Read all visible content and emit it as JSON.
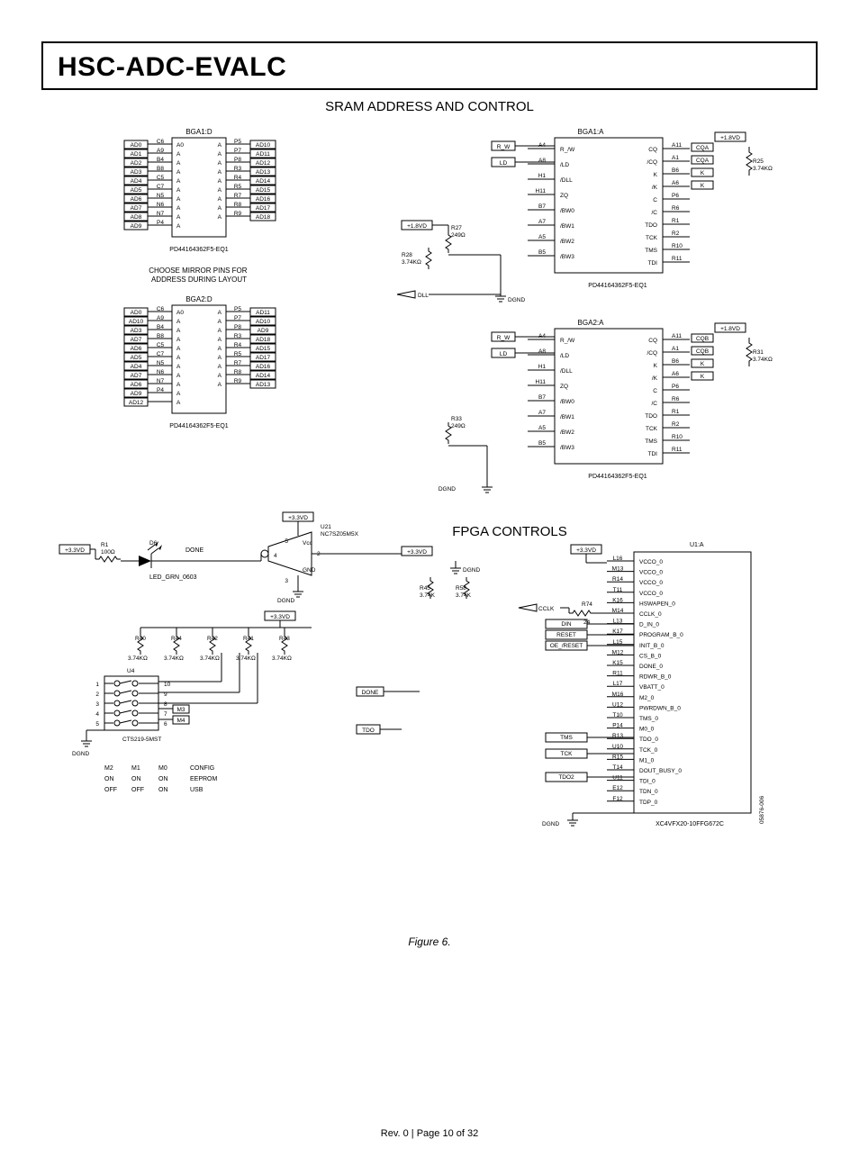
{
  "header": {
    "title": "HSC-ADC-EVALC"
  },
  "section1": {
    "title": "SRAM ADDRESS AND CONTROL"
  },
  "section2": {
    "title": "FPGA CONTROLS"
  },
  "figure_caption": "Figure 6.",
  "footer": "Rev. 0 | Page 10 of 32",
  "side_marker": "05876-006",
  "bga1d": {
    "name": "BGA1:D",
    "part": "PD44164362F5-EQ1",
    "left": [
      "AD0",
      "AD1",
      "AD2",
      "AD3",
      "AD4",
      "AD5",
      "AD6",
      "AD7",
      "AD8",
      "AD9"
    ],
    "left_pins": [
      "C6",
      "A9",
      "B4",
      "B8",
      "C5",
      "C7",
      "N5",
      "N6",
      "N7",
      "P4"
    ],
    "left_sig": [
      "A0",
      "A",
      "A",
      "A",
      "A",
      "A",
      "A",
      "A",
      "A",
      "A"
    ],
    "right_sig": [
      "A",
      "A",
      "A",
      "A",
      "A",
      "A",
      "A",
      "A",
      "A"
    ],
    "right_pins": [
      "P5",
      "P7",
      "P8",
      "R3",
      "R4",
      "R5",
      "R7",
      "R8",
      "R9"
    ],
    "right": [
      "AD10",
      "AD11",
      "AD12",
      "AD13",
      "AD14",
      "AD15",
      "AD16",
      "AD17",
      "AD18"
    ]
  },
  "note1": "CHOOSE MIRROR PINS FOR\nADDRESS DURING LAYOUT",
  "bga2d": {
    "name": "BGA2:D",
    "part": "PD44164362F5-EQ1",
    "left": [
      "AD0",
      "AD10",
      "AD3",
      "AD7",
      "AD6",
      "AD5",
      "AD4",
      "AD7",
      "AD6",
      "AD9",
      "AD12"
    ],
    "left_pins": [
      "C6",
      "A9",
      "B4",
      "B8",
      "C5",
      "C7",
      "N5",
      "N6",
      "N7",
      "P4",
      ""
    ],
    "left_sig": [
      "A0",
      "A",
      "A",
      "A",
      "A",
      "A",
      "A",
      "A",
      "A",
      "A",
      "A"
    ],
    "right_sig": [
      "A",
      "A",
      "A",
      "A",
      "A",
      "A",
      "A",
      "A",
      "A"
    ],
    "right_pins": [
      "P5",
      "P7",
      "P8",
      "R3",
      "R4",
      "R5",
      "R7",
      "R8",
      "R9"
    ],
    "right": [
      "AD11",
      "AD10",
      "AD9",
      "AD18",
      "AD15",
      "AD17",
      "AD16",
      "AD14",
      "AD13"
    ]
  },
  "bga1a": {
    "name": "BGA1:A",
    "part": "PD44164362F5-EQ1",
    "rows_left": [
      {
        "in": "R_W",
        "pin": "A4",
        "sig": "R_/W"
      },
      {
        "in": "LD",
        "pin": "A8",
        "sig": "/LD"
      },
      {
        "in": "",
        "pin": "H1",
        "sig": "/DLL"
      },
      {
        "in": "",
        "pin": "H11",
        "sig": "ZQ"
      },
      {
        "in": "",
        "pin": "B7",
        "sig": "/BW0"
      },
      {
        "in": "",
        "pin": "A7",
        "sig": "/BW1"
      },
      {
        "in": "",
        "pin": "A5",
        "sig": "/BW2"
      },
      {
        "in": "",
        "pin": "B5",
        "sig": "/BW3"
      }
    ],
    "rows_right": [
      {
        "sig": "CQ",
        "pin": "A11",
        "out": "CQA"
      },
      {
        "sig": "/CQ",
        "pin": "A1",
        "out": "CQA"
      },
      {
        "sig": "K",
        "pin": "B6",
        "out": "K"
      },
      {
        "sig": "/K",
        "pin": "A6",
        "out": "K"
      },
      {
        "sig": "C",
        "pin": "P6",
        "out": ""
      },
      {
        "sig": "/C",
        "pin": "R6",
        "out": ""
      },
      {
        "sig": "TDO",
        "pin": "R1",
        "out": ""
      },
      {
        "sig": "TCK",
        "pin": "R2",
        "out": ""
      },
      {
        "sig": "TMS",
        "pin": "R10",
        "out": ""
      },
      {
        "sig": "TDI",
        "pin": "R11",
        "out": ""
      }
    ],
    "r25": "R25\n3.74KΩ",
    "r27": "R27\n249Ω",
    "r28": "R28\n3.74KΩ",
    "pwr": "+1.8VD",
    "dll": "DLL",
    "gnd": "DGND"
  },
  "bga2a": {
    "name": "BGA2:A",
    "part": "PD44164362F5-EQ1",
    "r31": "R31\n3.74KΩ",
    "r33": "R33\n249Ω",
    "cqb": "CQB",
    "gnd": "DGND"
  },
  "fpga": {
    "d6": "D6",
    "r1": "R1\n100Ω",
    "done": "DONE",
    "led": "LED_GRN_0603",
    "u21": "U21\nNC7SZ05M5X",
    "vcc33": "+3.3VD",
    "gnd": "GND",
    "dgnd": "DGND",
    "resistors": [
      "R40\n3.74KΩ",
      "R44\n3.74KΩ",
      "R42\n3.74KΩ",
      "R41\n3.74KΩ",
      "R43\n3.74KΩ"
    ],
    "u4": "U4",
    "cts": "CTS219-5MST",
    "m3": "M3",
    "m4": "M4",
    "r45": "R45\n3.74K",
    "r58": "R58\n3.74K",
    "r74": [
      "R74",
      "24"
    ],
    "signals_left": [
      "DIN",
      "RESET",
      "OE_/RESET",
      "DONE",
      "TDO",
      "TMS",
      "TCK",
      "TDO2",
      "CCLK"
    ],
    "u1": "U1:A",
    "xc": "XC4VFX20-10FFG672C",
    "u1_rows": [
      {
        "pin": "L16",
        "sig": "VCCO_0"
      },
      {
        "pin": "M13",
        "sig": "VCCO_0"
      },
      {
        "pin": "R14",
        "sig": "VCCO_0"
      },
      {
        "pin": "T11",
        "sig": "VCCO_0"
      },
      {
        "pin": "K16",
        "sig": "HSWAPEN_0"
      },
      {
        "pin": "M14",
        "sig": "CCLK_0"
      },
      {
        "pin": "L13",
        "sig": "D_IN_0"
      },
      {
        "pin": "K17",
        "sig": "PROGRAM_B_0"
      },
      {
        "pin": "L15",
        "sig": "INIT_B_0"
      },
      {
        "pin": "M12",
        "sig": "CS_B_0"
      },
      {
        "pin": "K15",
        "sig": "DONE_0"
      },
      {
        "pin": "R11",
        "sig": "RDWR_B_0"
      },
      {
        "pin": "L17",
        "sig": "VBATT_0"
      },
      {
        "pin": "M16",
        "sig": "M2_0"
      },
      {
        "pin": "U12",
        "sig": "PWRDWN_B_0"
      },
      {
        "pin": "T10",
        "sig": "TMS_0"
      },
      {
        "pin": "P14",
        "sig": "M0_0"
      },
      {
        "pin": "R13",
        "sig": "TDO_0"
      },
      {
        "pin": "U10",
        "sig": "TCK_0"
      },
      {
        "pin": "R15",
        "sig": "M1_0"
      },
      {
        "pin": "T14",
        "sig": "DOUT_BUSY_0"
      },
      {
        "pin": "U11",
        "sig": "TDI_0"
      },
      {
        "pin": "E12",
        "sig": "TDN_0"
      },
      {
        "pin": "F12",
        "sig": "TDP_0"
      }
    ],
    "cfg_table": {
      "headers": [
        "M2",
        "M1",
        "M0",
        "CONFIG"
      ],
      "rows": [
        [
          "ON",
          "ON",
          "ON",
          "EEPROM"
        ],
        [
          "OFF",
          "OFF",
          "ON",
          "USB"
        ]
      ]
    }
  }
}
